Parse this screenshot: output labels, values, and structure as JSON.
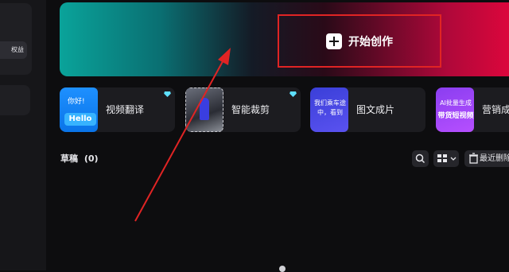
{
  "sidebar": {
    "promo_label": "权益"
  },
  "hero": {
    "create_label": "开始创作"
  },
  "tools": [
    {
      "label": "视频翻译",
      "thumb_top": "你好!",
      "thumb_bottom": "Hello",
      "premium": true
    },
    {
      "label": "智能裁剪",
      "premium": true
    },
    {
      "label": "图文成片",
      "thumb_text": "我们乘车途中，看到"
    },
    {
      "label": "营销成片",
      "thumb_top": "AI批量生成",
      "thumb_bottom": "带货短视频"
    }
  ],
  "drafts": {
    "title": "草稿",
    "count": "(0)"
  },
  "toolbar": {
    "recent_delete_label": "最近删除"
  },
  "annotation": {
    "color": "#e02424"
  }
}
